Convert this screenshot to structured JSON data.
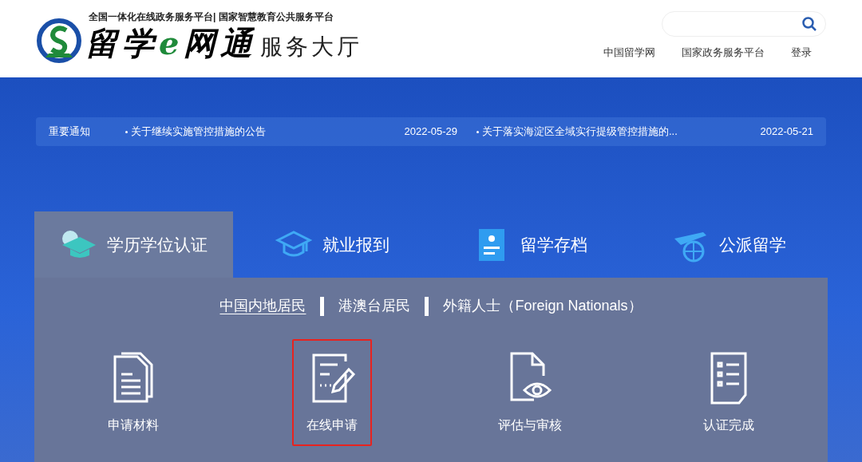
{
  "header": {
    "tagline": "全国一体化在线政务服务平台| 国家智慧教育公共服务平台",
    "brand": {
      "prefix": "留学",
      "accent": "e",
      "suffix": "网通",
      "tail": "服务大厅"
    },
    "links": [
      "中国留学网",
      "国家政务服务平台",
      "登录"
    ]
  },
  "notices": {
    "label": "重要通知",
    "items": [
      {
        "title": "关于继续实施管控措施的公告",
        "date": "2022-05-29"
      },
      {
        "title": "关于落实海淀区全域实行提级管控措施的...",
        "date": "2022-05-21"
      }
    ]
  },
  "tabs": [
    {
      "kind": "graduation",
      "label": "学历学位认证",
      "selected": true
    },
    {
      "kind": "cap",
      "label": "就业报到",
      "selected": false
    },
    {
      "kind": "folder",
      "label": "留学存档",
      "selected": false
    },
    {
      "kind": "plane",
      "label": "公派留学",
      "selected": false
    }
  ],
  "subtabs": [
    {
      "label": "中国内地居民",
      "selected": true
    },
    {
      "label": "港澳台居民",
      "selected": false
    },
    {
      "label": "外籍人士（Foreign Nationals）",
      "selected": false
    }
  ],
  "steps": [
    {
      "kind": "documents",
      "label": "申请材料",
      "highlighted": false
    },
    {
      "kind": "form",
      "label": "在线申请",
      "highlighted": true
    },
    {
      "kind": "review",
      "label": "评估与审核",
      "highlighted": false
    },
    {
      "kind": "checklist",
      "label": "认证完成",
      "highlighted": false
    }
  ]
}
